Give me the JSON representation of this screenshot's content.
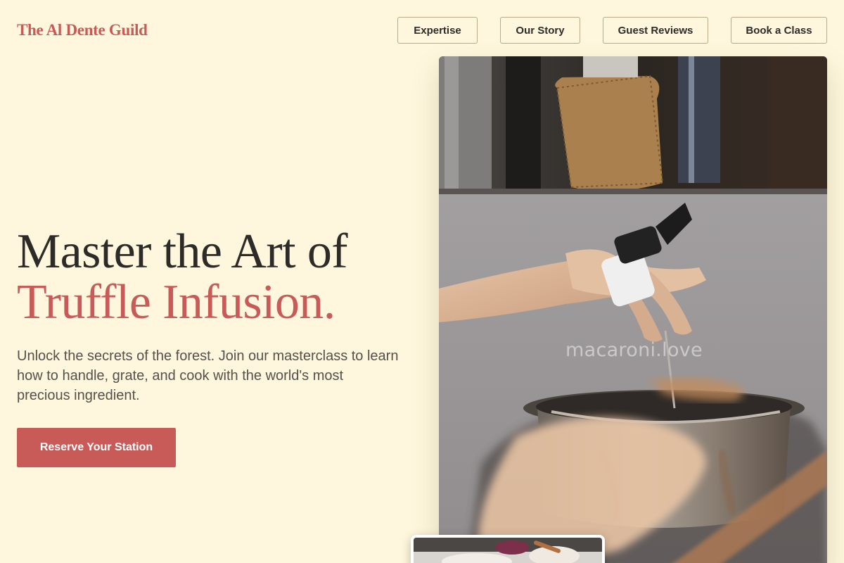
{
  "brand": {
    "name": "The Al Dente Guild",
    "color": "#c85b58"
  },
  "nav": {
    "items": [
      {
        "label": "Expertise"
      },
      {
        "label": "Our Story"
      },
      {
        "label": "Guest Reviews"
      },
      {
        "label": "Book a Class"
      }
    ]
  },
  "hero": {
    "heading_line1": "Master the Art of",
    "heading_line2": "Truffle Infusion.",
    "description": "Unlock the secrets of the forest. Join our masterclass to learn how to handle, grate, and cook with the world's most precious ingredient.",
    "cta_label": "Reserve Your Station"
  },
  "photo": {
    "watermark": "macaroni.love",
    "subject": "hands seasoning a steel cooking pot on a stove"
  },
  "colors": {
    "background": "#fef7dd",
    "accent": "#c85b58",
    "text": "#2d2b28",
    "muted_text": "#55504b"
  }
}
